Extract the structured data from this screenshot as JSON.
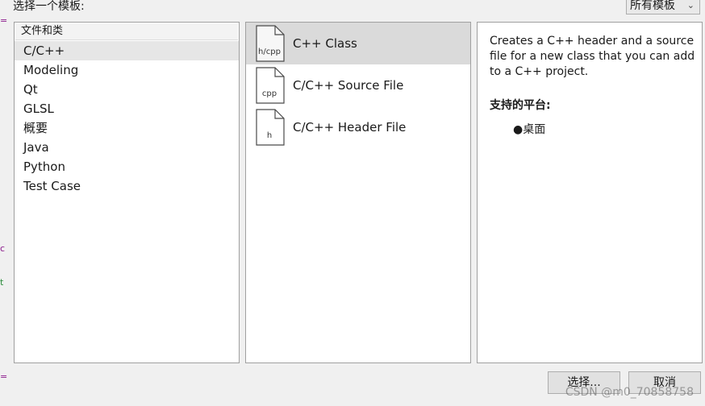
{
  "dialog": {
    "choose_template_label": "选择一个模板:",
    "filter_selected": "所有模板"
  },
  "categories": {
    "header": "文件和类",
    "items": [
      "C/C++",
      "Modeling",
      "Qt",
      "GLSL",
      "概要",
      "Java",
      "Python",
      "Test Case"
    ],
    "selected": "C/C++"
  },
  "templates": [
    {
      "label": "C++ Class",
      "icon_text": "h/cpp",
      "selected": true
    },
    {
      "label": "C/C++ Source File",
      "icon_text": "cpp",
      "selected": false
    },
    {
      "label": "C/C++ Header File",
      "icon_text": "h",
      "selected": false
    }
  ],
  "description": {
    "text": "Creates a C++ header and a source file for a new class that you can add to a C++ project.",
    "platforms_title": "支持的平台:",
    "platforms": [
      "桌面"
    ]
  },
  "buttons": {
    "choose": "选择...",
    "cancel": "取消"
  },
  "watermark": "CSDN @m0_70858758",
  "colors": {
    "selected_template_bg": "#dadada",
    "panel_border": "#a0a0a0",
    "edge_purple": "#8b1a8b",
    "edge_green": "#2a8a3a"
  }
}
